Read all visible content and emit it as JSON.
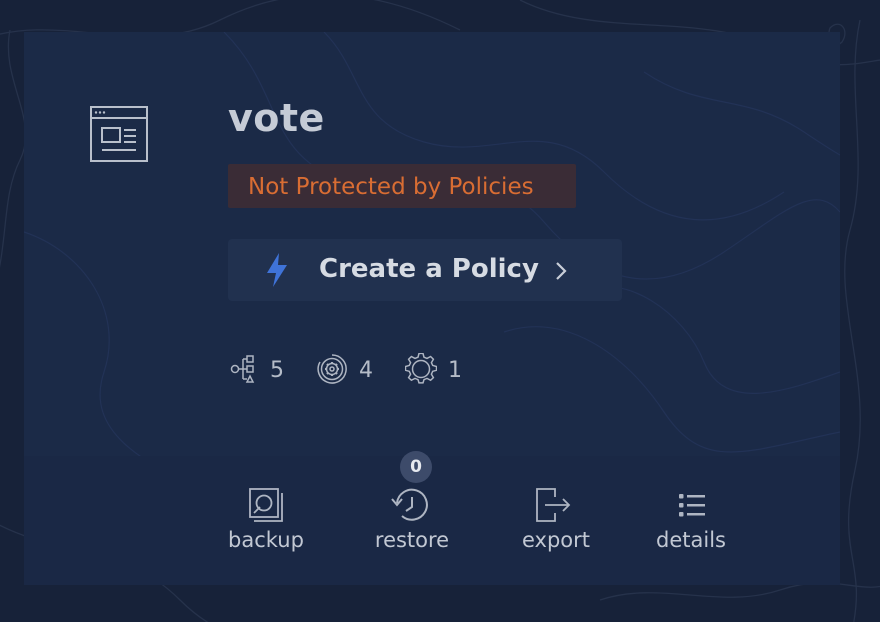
{
  "app": {
    "name": "vote",
    "icon": "application-window-icon"
  },
  "status": {
    "text": "Not Protected by Policies",
    "color": "#d96d33"
  },
  "create_policy": {
    "label": "Create a Policy",
    "icon": "lightning-bolt-icon",
    "accent": "#3f73d8"
  },
  "stats": [
    {
      "icon": "workload-tree-icon",
      "count": "5"
    },
    {
      "icon": "service-gear-ring-icon",
      "count": "4"
    },
    {
      "icon": "gear-icon",
      "count": "1"
    }
  ],
  "actions": {
    "backup": {
      "label": "backup",
      "icon": "backup-icon"
    },
    "restore": {
      "label": "restore",
      "icon": "history-icon",
      "badge": "0"
    },
    "export": {
      "label": "export",
      "icon": "export-icon"
    },
    "details": {
      "label": "details",
      "icon": "list-icon"
    }
  }
}
